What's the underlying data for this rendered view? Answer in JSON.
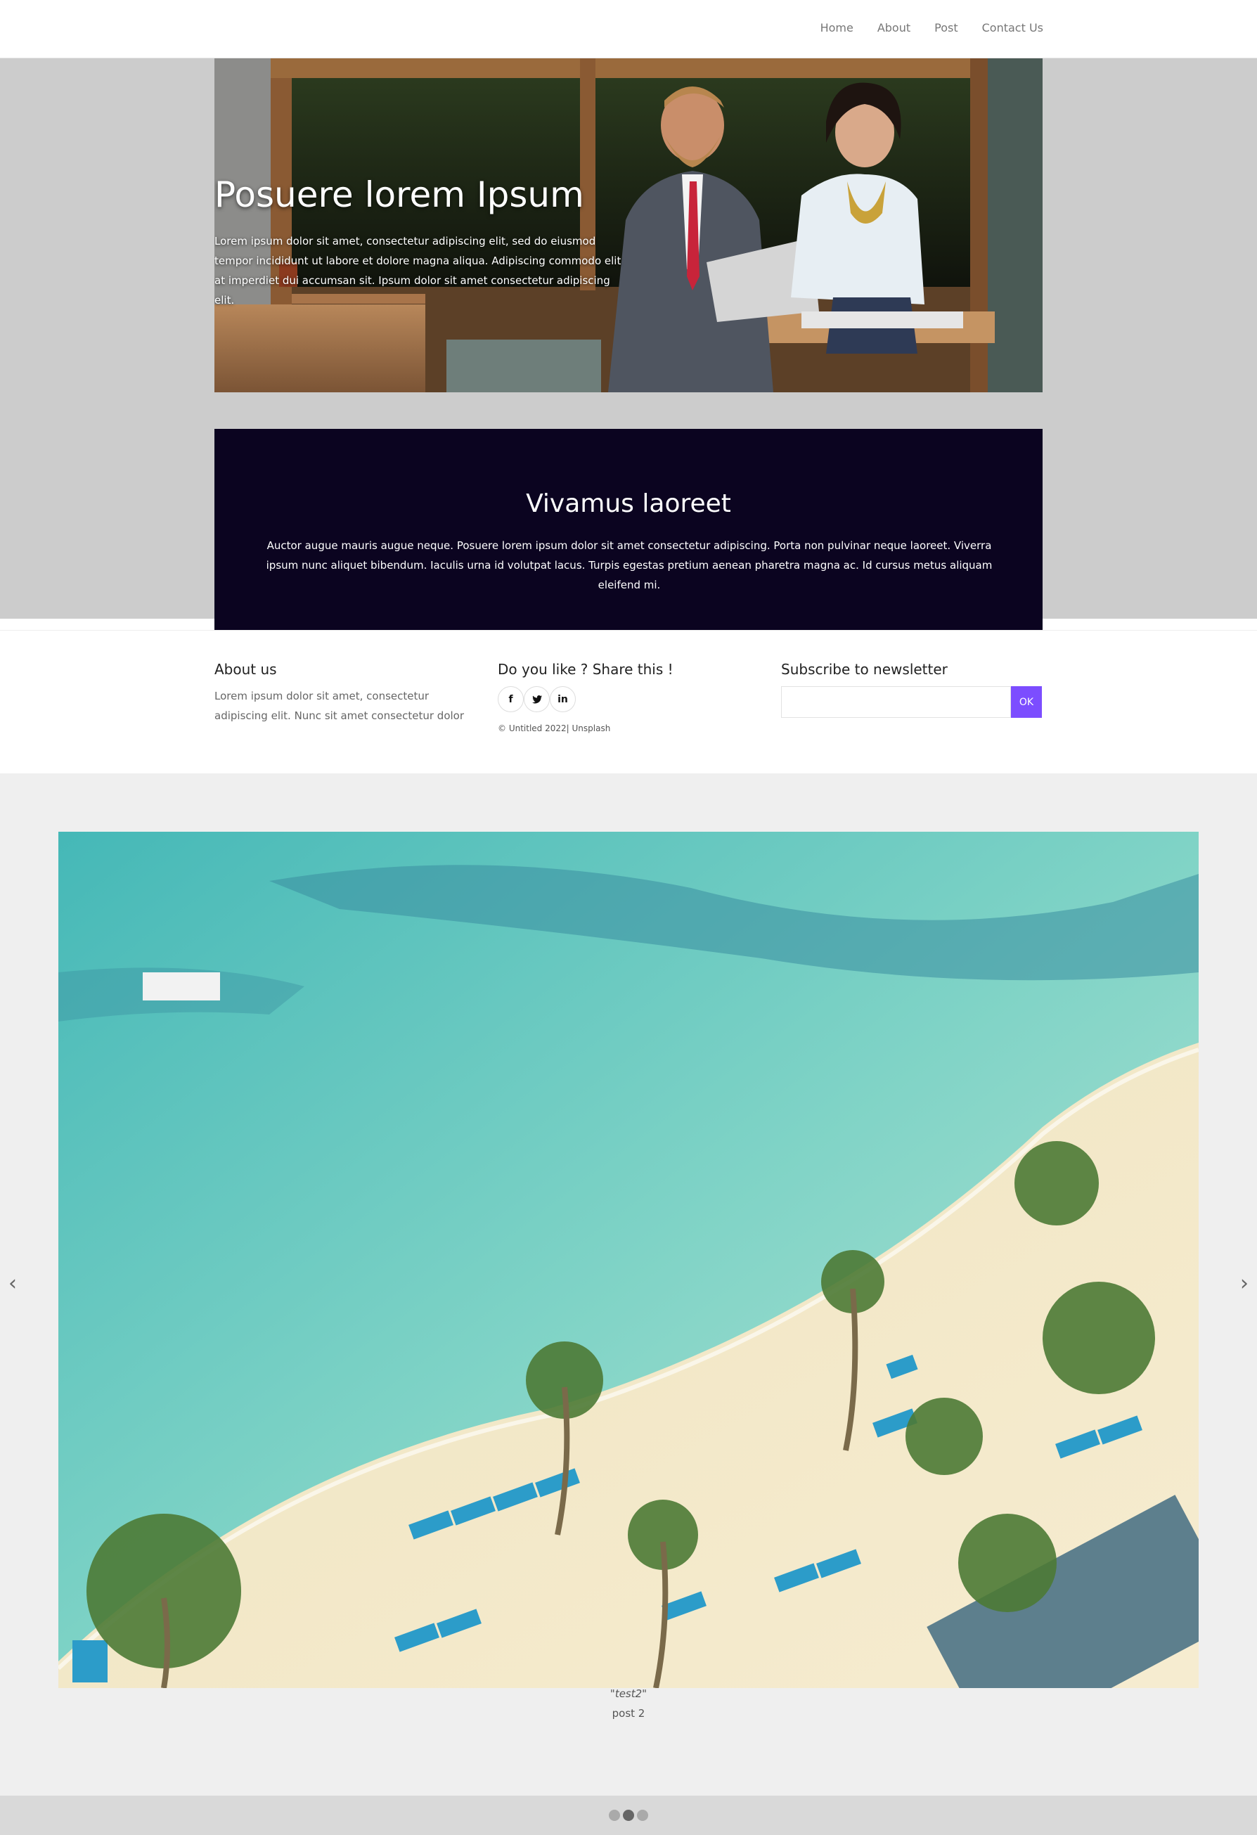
{
  "nav": {
    "items": [
      {
        "label": "Home"
      },
      {
        "label": "About"
      },
      {
        "label": "Post"
      },
      {
        "label": "Contact Us"
      }
    ]
  },
  "hero": {
    "title": "Posuere lorem Ipsum",
    "text": "Lorem ipsum dolor sit amet, consectetur adipiscing elit, sed do eiusmod tempor incididunt ut labore et dolore magna aliqua. Adipiscing commodo elit at imperdiet dui accumsan sit. Ipsum dolor sit amet consectetur adipiscing elit."
  },
  "feature": {
    "title": "Vivamus laoreet",
    "text": "Auctor augue mauris augue neque. Posuere lorem ipsum dolor sit amet consectetur adipiscing. Porta non pulvinar neque laoreet. Viverra ipsum nunc aliquet bibendum. Iaculis urna id volutpat lacus. Turpis egestas pretium aenean pharetra magna ac. Id cursus metus aliquam eleifend mi."
  },
  "about": {
    "heading": "About us",
    "text": "Lorem ipsum dolor sit amet, consectetur adipiscing elit. Nunc sit amet consectetur dolor"
  },
  "share": {
    "heading": "Do you like ? Share this !",
    "icons": [
      {
        "name": "facebook-icon",
        "glyph": "f"
      },
      {
        "name": "twitter-icon",
        "glyph": "🐦"
      },
      {
        "name": "linkedin-icon",
        "glyph": "in"
      }
    ],
    "copyright": "© Untitled 2022| Unsplash"
  },
  "newsletter": {
    "heading": "Subscribe to newsletter",
    "input_value": "",
    "button_label": "OK"
  },
  "carousel": {
    "caption_quote": "\"test2\"",
    "caption_sub": "post 2",
    "prev_arrow": "‹",
    "next_arrow": "›",
    "active_index": 1,
    "dot_count": 3
  },
  "colors": {
    "accent": "#7c4dff",
    "feature_bg": "#0b0420",
    "gray_band": "#cccccc"
  }
}
